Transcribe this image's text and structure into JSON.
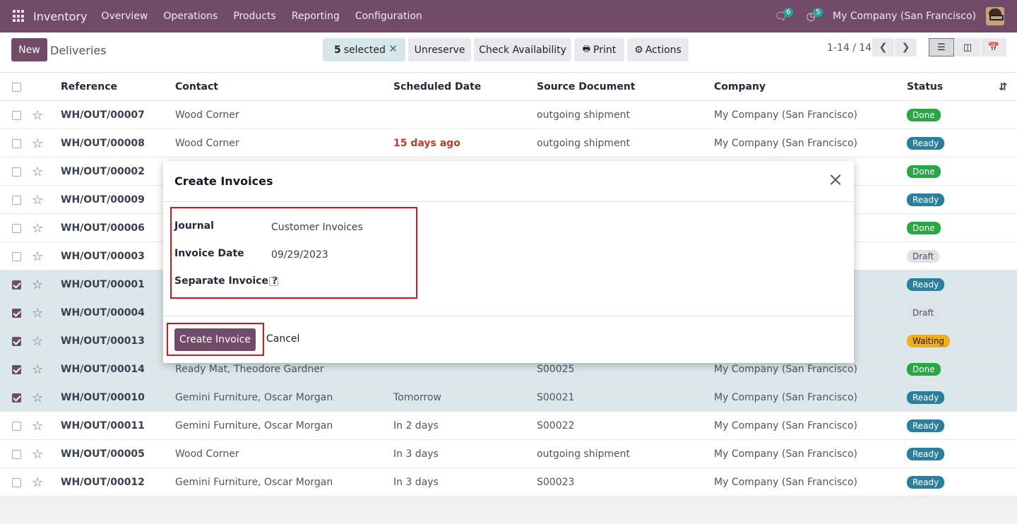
{
  "navbar": {
    "brand": "Inventory",
    "menu": [
      "Overview",
      "Operations",
      "Products",
      "Reporting",
      "Configuration"
    ],
    "messages_count": "6",
    "activities_count": "5",
    "company": "My Company (San Francisco)"
  },
  "control_panel": {
    "new_label": "New",
    "breadcrumb": "Deliveries",
    "selected_count": "5",
    "selected_label": "selected",
    "actions": {
      "unreserve": "Unreserve",
      "check_availability": "Check Availability",
      "print": "Print",
      "actions": "Actions"
    },
    "pager": "1-14 / 14"
  },
  "list": {
    "columns": [
      "Reference",
      "Contact",
      "Scheduled Date",
      "Source Document",
      "Company",
      "Status"
    ],
    "rows": [
      {
        "ref": "WH/OUT/00007",
        "contact": "Wood Corner",
        "date": "",
        "source": "outgoing shipment",
        "company": "My Company (San Francisco)",
        "status": "Done",
        "selected": false,
        "late": false
      },
      {
        "ref": "WH/OUT/00008",
        "contact": "Wood Corner",
        "date": "15 days ago",
        "source": "outgoing shipment",
        "company": "My Company (San Francisco)",
        "status": "Ready",
        "selected": false,
        "late": true
      },
      {
        "ref": "WH/OUT/00002",
        "contact": "",
        "date": "",
        "source": "",
        "company": "",
        "status": "Done",
        "selected": false,
        "late": false
      },
      {
        "ref": "WH/OUT/00009",
        "contact": "",
        "date": "",
        "source": "",
        "company": "",
        "status": "Ready",
        "selected": false,
        "late": false
      },
      {
        "ref": "WH/OUT/00006",
        "contact": "",
        "date": "",
        "source": "",
        "company": "",
        "status": "Done",
        "selected": false,
        "late": false
      },
      {
        "ref": "WH/OUT/00003",
        "contact": "",
        "date": "",
        "source": "",
        "company": "",
        "status": "Draft",
        "selected": false,
        "late": false
      },
      {
        "ref": "WH/OUT/00001",
        "contact": "",
        "date": "",
        "source": "",
        "company": "",
        "status": "Ready",
        "selected": true,
        "late": false
      },
      {
        "ref": "WH/OUT/00004",
        "contact": "",
        "date": "",
        "source": "",
        "company": "",
        "status": "Draft",
        "selected": true,
        "late": false
      },
      {
        "ref": "WH/OUT/00013",
        "contact": "",
        "date": "",
        "source": "",
        "company": "",
        "status": "Waiting",
        "selected": true,
        "late": false
      },
      {
        "ref": "WH/OUT/00014",
        "contact": "Ready Mat, Theodore Gardner",
        "date": "",
        "source": "S00025",
        "company": "My Company (San Francisco)",
        "status": "Done",
        "selected": true,
        "late": false
      },
      {
        "ref": "WH/OUT/00010",
        "contact": "Gemini Furniture, Oscar Morgan",
        "date": "Tomorrow",
        "source": "S00021",
        "company": "My Company (San Francisco)",
        "status": "Ready",
        "selected": true,
        "late": false
      },
      {
        "ref": "WH/OUT/00011",
        "contact": "Gemini Furniture, Oscar Morgan",
        "date": "In 2 days",
        "source": "S00022",
        "company": "My Company (San Francisco)",
        "status": "Ready",
        "selected": false,
        "late": false
      },
      {
        "ref": "WH/OUT/00005",
        "contact": "Wood Corner",
        "date": "In 3 days",
        "source": "outgoing shipment",
        "company": "My Company (San Francisco)",
        "status": "Ready",
        "selected": false,
        "late": false
      },
      {
        "ref": "WH/OUT/00012",
        "contact": "Gemini Furniture, Oscar Morgan",
        "date": "In 3 days",
        "source": "S00023",
        "company": "My Company (San Francisco)",
        "status": "Ready",
        "selected": false,
        "late": false
      }
    ]
  },
  "modal": {
    "title": "Create Invoices",
    "journal_label": "Journal",
    "journal_value": "Customer Invoices",
    "invoice_date_label": "Invoice Date",
    "invoice_date_value": "09/29/2023",
    "separate_label": "Separate Invoice ?",
    "create_label": "Create Invoice",
    "cancel_label": "Cancel"
  },
  "colors": {
    "brand": "#714b67",
    "highlight": "#d9141e",
    "done": "#28a745",
    "ready": "#2a7f9e",
    "waiting": "#f0ad1e"
  }
}
